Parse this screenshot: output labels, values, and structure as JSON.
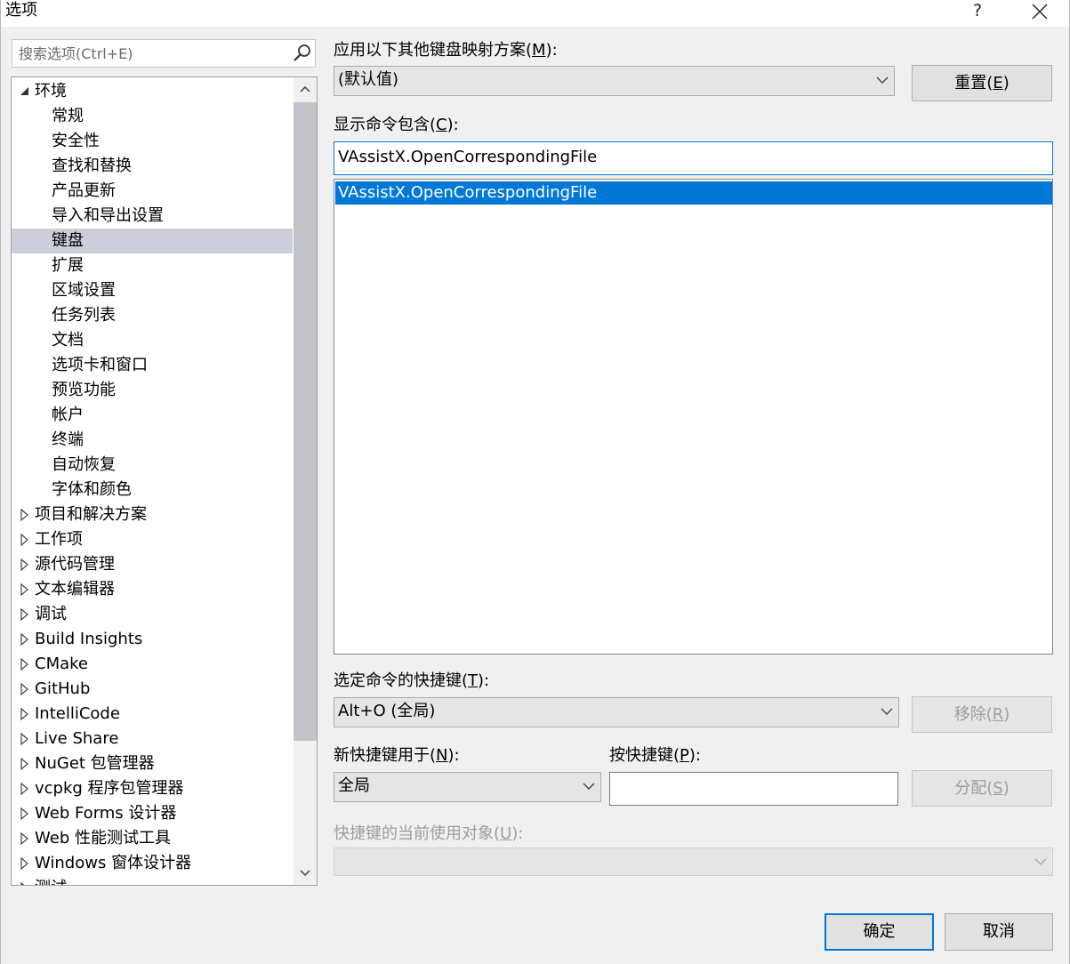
{
  "window": {
    "title": "选项",
    "help_label": "?",
    "close_label": "✕"
  },
  "search": {
    "placeholder": "搜索选项(Ctrl+E)"
  },
  "tree": {
    "items": [
      {
        "label": "环境",
        "level": 0,
        "expanded": true
      },
      {
        "label": "常规",
        "level": 1
      },
      {
        "label": "安全性",
        "level": 1
      },
      {
        "label": "查找和替换",
        "level": 1
      },
      {
        "label": "产品更新",
        "level": 1
      },
      {
        "label": "导入和导出设置",
        "level": 1
      },
      {
        "label": "键盘",
        "level": 1,
        "selected": true
      },
      {
        "label": "扩展",
        "level": 1
      },
      {
        "label": "区域设置",
        "level": 1
      },
      {
        "label": "任务列表",
        "level": 1
      },
      {
        "label": "文档",
        "level": 1
      },
      {
        "label": "选项卡和窗口",
        "level": 1
      },
      {
        "label": "预览功能",
        "level": 1
      },
      {
        "label": "帐户",
        "level": 1
      },
      {
        "label": "终端",
        "level": 1
      },
      {
        "label": "自动恢复",
        "level": 1
      },
      {
        "label": "字体和颜色",
        "level": 1
      },
      {
        "label": "项目和解决方案",
        "level": 0
      },
      {
        "label": "工作项",
        "level": 0
      },
      {
        "label": "源代码管理",
        "level": 0
      },
      {
        "label": "文本编辑器",
        "level": 0
      },
      {
        "label": "调试",
        "level": 0
      },
      {
        "label": "Build Insights",
        "level": 0
      },
      {
        "label": "CMake",
        "level": 0
      },
      {
        "label": "GitHub",
        "level": 0
      },
      {
        "label": "IntelliCode",
        "level": 0
      },
      {
        "label": "Live Share",
        "level": 0
      },
      {
        "label": "NuGet 包管理器",
        "level": 0
      },
      {
        "label": "vcpkg 程序包管理器",
        "level": 0
      },
      {
        "label": "Web Forms 设计器",
        "level": 0
      },
      {
        "label": "Web 性能测试工具",
        "level": 0
      },
      {
        "label": "Windows 窗体设计器",
        "level": 0
      },
      {
        "label": "测试",
        "level": 0
      }
    ]
  },
  "mapping": {
    "label_pre": "应用以下其他键盘映射方案(",
    "label_key": "M",
    "label_post": "):",
    "value": "(默认值)",
    "reset_pre": "重置(",
    "reset_key": "E",
    "reset_post": ")"
  },
  "commands": {
    "label_pre": "显示命令包含(",
    "label_key": "C",
    "label_post": "):",
    "filter_value": "VAssistX.OpenCorrespondingFile",
    "list": [
      "VAssistX.OpenCorrespondingFile"
    ]
  },
  "shortcuts": {
    "label_pre": "选定命令的快捷键(",
    "label_key": "T",
    "label_post": "):",
    "value": "Alt+O (全局)",
    "remove_pre": "移除(",
    "remove_key": "R",
    "remove_post": ")"
  },
  "new_shortcut": {
    "scope_label_pre": "新快捷键用于(",
    "scope_label_key": "N",
    "scope_label_post": "):",
    "scope_value": "全局",
    "press_label_pre": "按快捷键(",
    "press_label_key": "P",
    "press_label_post": "):",
    "press_value": "",
    "assign_pre": "分配(",
    "assign_key": "S",
    "assign_post": ")"
  },
  "current_use": {
    "label_pre": "快捷键的当前使用对象(",
    "label_key": "U",
    "label_post": "):",
    "value": ""
  },
  "footer": {
    "ok_label": "确定",
    "cancel_label": "取消"
  },
  "colors": {
    "accent": "#0078d7",
    "tree_selection": "#cccedb",
    "disabled_text": "#9d9d9d"
  }
}
